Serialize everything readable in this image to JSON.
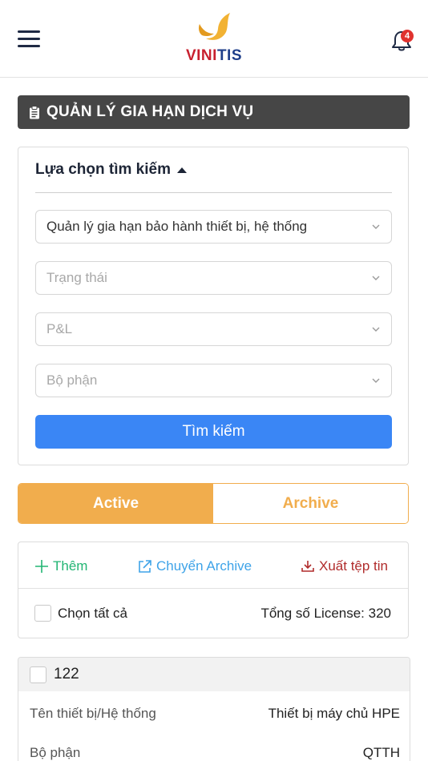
{
  "header": {
    "logo_text_vi": "VINI",
    "logo_text_tis": "TIS",
    "notification_count": "4",
    "colors": {
      "brand_red": "#c8202f",
      "brand_blue": "#1f3f8a",
      "logo_gold": "#f2b233"
    }
  },
  "page": {
    "title": "QUẢN LÝ GIA HẠN DỊCH VỤ"
  },
  "search": {
    "heading": "Lựa chọn tìm kiếm",
    "service_type_value": "Quản lý gia hạn bảo hành thiết bị, hệ thống",
    "status_placeholder": "Trạng thái",
    "pl_placeholder": "P&L",
    "department_placeholder": "Bộ phận",
    "search_button": "Tìm kiếm"
  },
  "tabs": {
    "active_label": "Active",
    "archive_label": "Archive",
    "accent_color": "#f1ad4d"
  },
  "actions": {
    "add_label": "Thêm",
    "move_archive_label": "Chuyển Archive",
    "export_label": "Xuất tệp tin",
    "select_all_label": "Chọn tất cả",
    "total_label": "Tổng số License: 320"
  },
  "records": [
    {
      "id": "122",
      "fields": [
        {
          "label": "Tên thiết bị/Hệ thống",
          "value": "Thiết bị máy chủ HPE"
        },
        {
          "label": "Bộ phận",
          "value": "QTTH"
        }
      ]
    }
  ],
  "icons": [
    "menu-icon",
    "bell-icon",
    "clipboard-icon",
    "caret-up-icon",
    "chevron-down-icon",
    "plus-icon",
    "external-link-icon",
    "download-icon"
  ]
}
